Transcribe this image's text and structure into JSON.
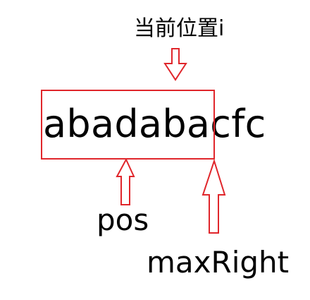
{
  "labels": {
    "current_position": "当前位置i",
    "string_highlighted": "abadaba",
    "string_rest": "cfc",
    "pos": "pos",
    "max_right": "maxRight"
  },
  "colors": {
    "highlight_box": "#e0262b",
    "arrow_stroke": "#e0262b",
    "text": "#000000",
    "background": "#ffffff"
  },
  "icons": {
    "current_arrow": "down-arrow-icon",
    "pos_arrow": "up-arrow-icon",
    "max_right_arrow": "up-arrow-icon"
  }
}
